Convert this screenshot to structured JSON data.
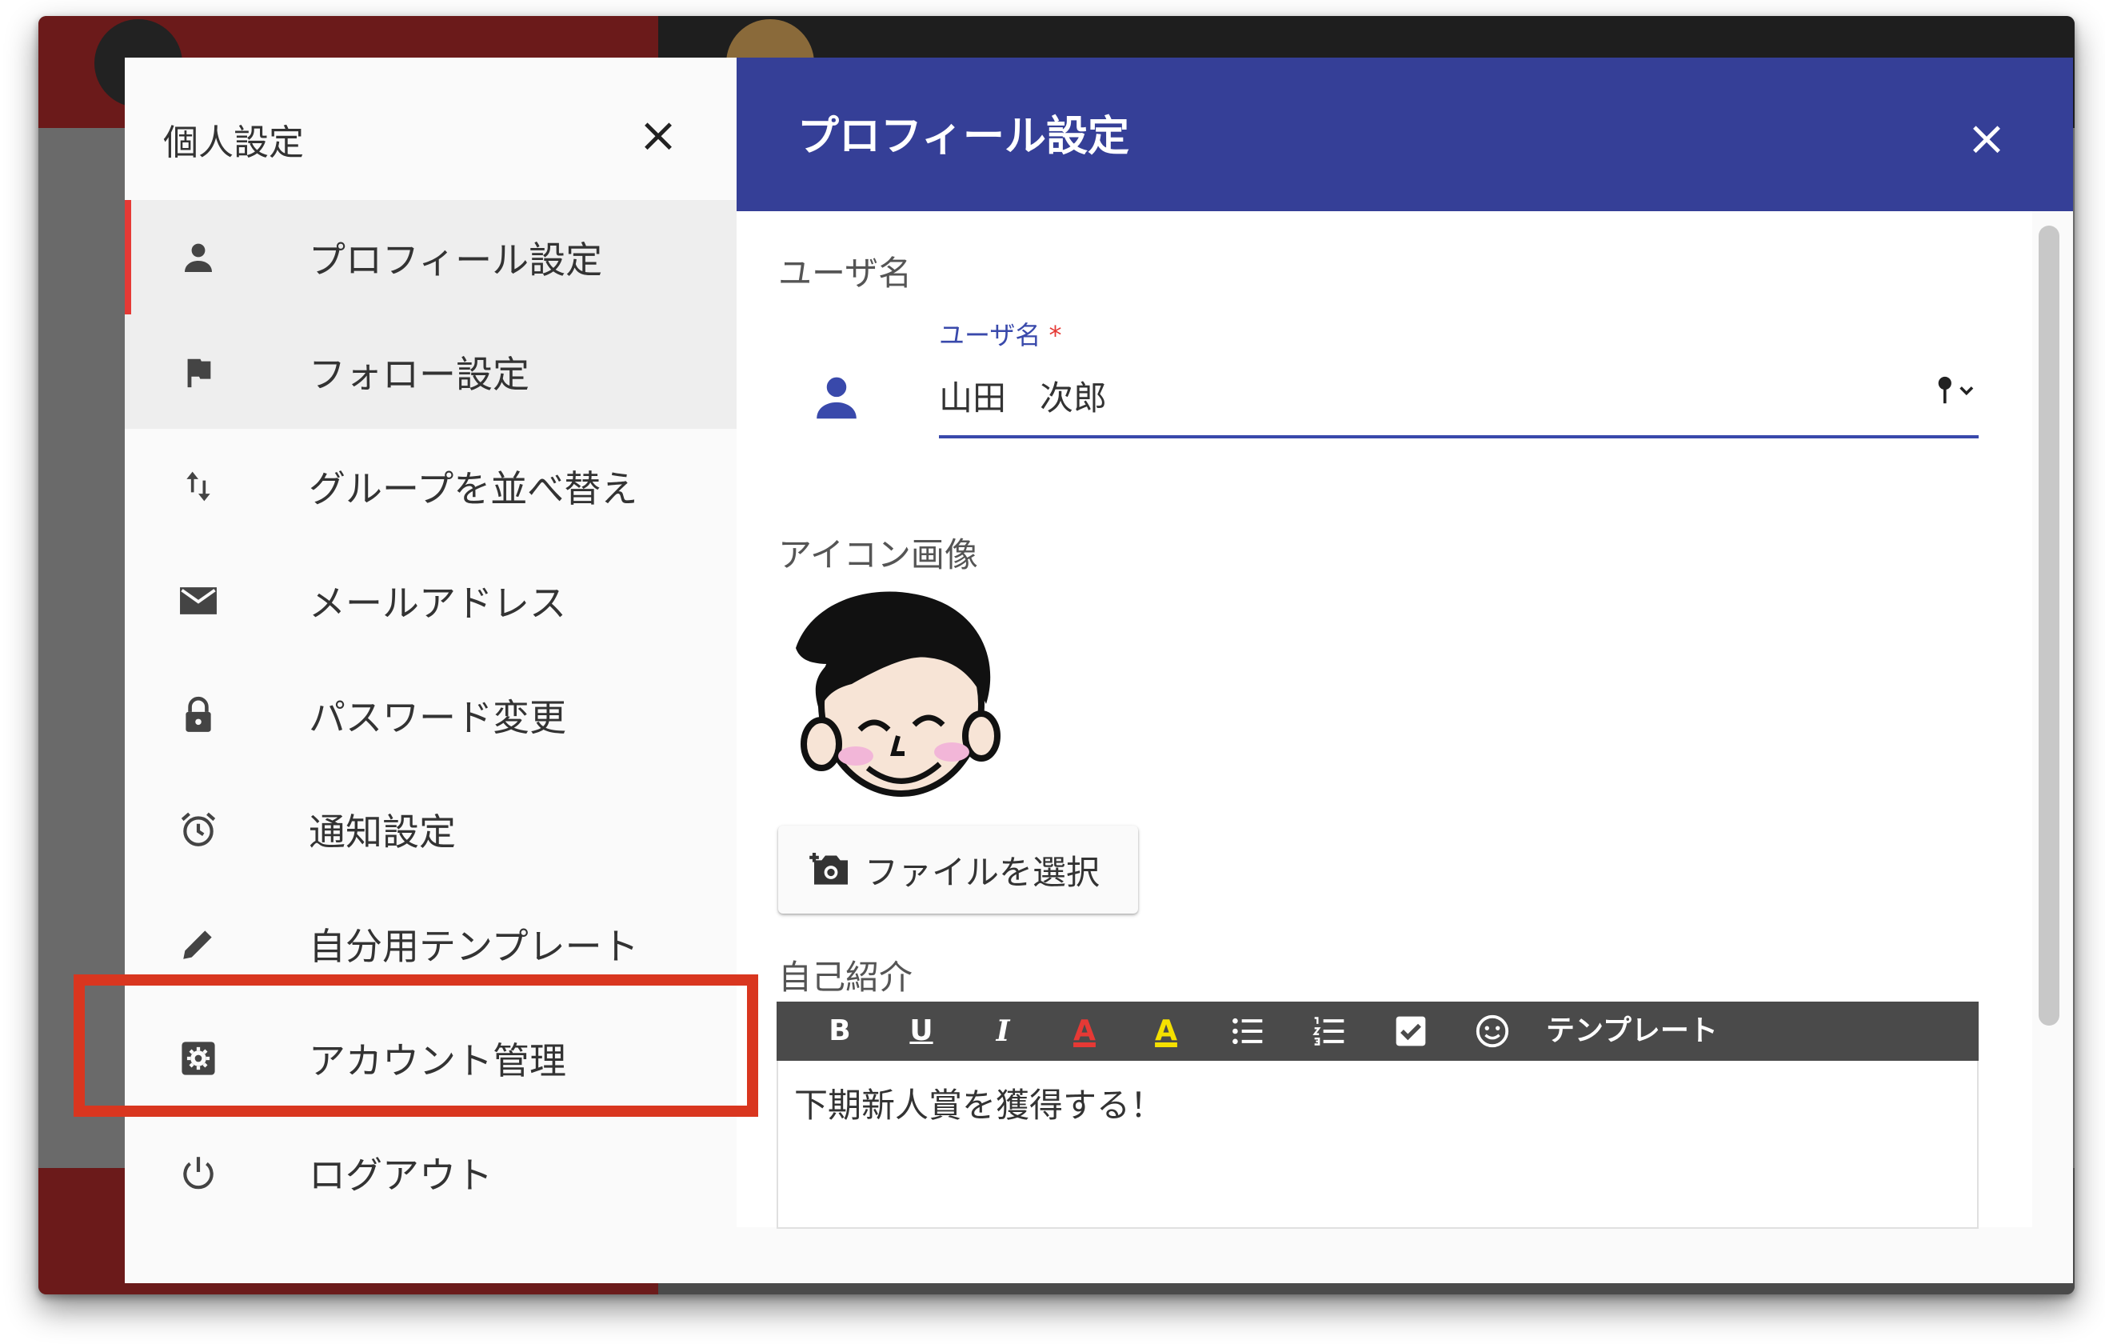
{
  "settings_panel": {
    "title": "個人設定",
    "close_label": "×",
    "items": [
      {
        "label": "プロフィール設定",
        "icon": "person-icon"
      },
      {
        "label": "フォロー設定",
        "icon": "flag-icon"
      },
      {
        "label": "グループを並べ替え",
        "icon": "sort-arrows-icon"
      },
      {
        "label": "メールアドレス",
        "icon": "mail-icon"
      },
      {
        "label": "パスワード変更",
        "icon": "lock-icon"
      },
      {
        "label": "通知設定",
        "icon": "alarm-icon"
      },
      {
        "label": "自分用テンプレート",
        "icon": "pencil-icon"
      },
      {
        "label": "アカウント管理",
        "icon": "account-settings-icon"
      },
      {
        "label": "ログアウト",
        "icon": "power-icon"
      }
    ]
  },
  "dialog": {
    "title": "プロフィール設定",
    "close_label": "×",
    "username_section": "ユーザ名",
    "username_field_label": "ユーザ名",
    "required_mark": "*",
    "username_value": "山田　次郎",
    "icon_section": "アイコン画像",
    "file_button_label": "ファイルを選択",
    "intro_section": "自己紹介",
    "toolbar": {
      "bold": "B",
      "underline": "U",
      "italic": "I",
      "font_color": "A",
      "highlight": "A",
      "template": "テンプレート"
    },
    "intro_text": "下期新人賞を獲得する！"
  },
  "colors": {
    "header": "#353f97",
    "accent": "#3949ab",
    "active_marker": "#e53935",
    "highlight_box": "#d9361f"
  }
}
